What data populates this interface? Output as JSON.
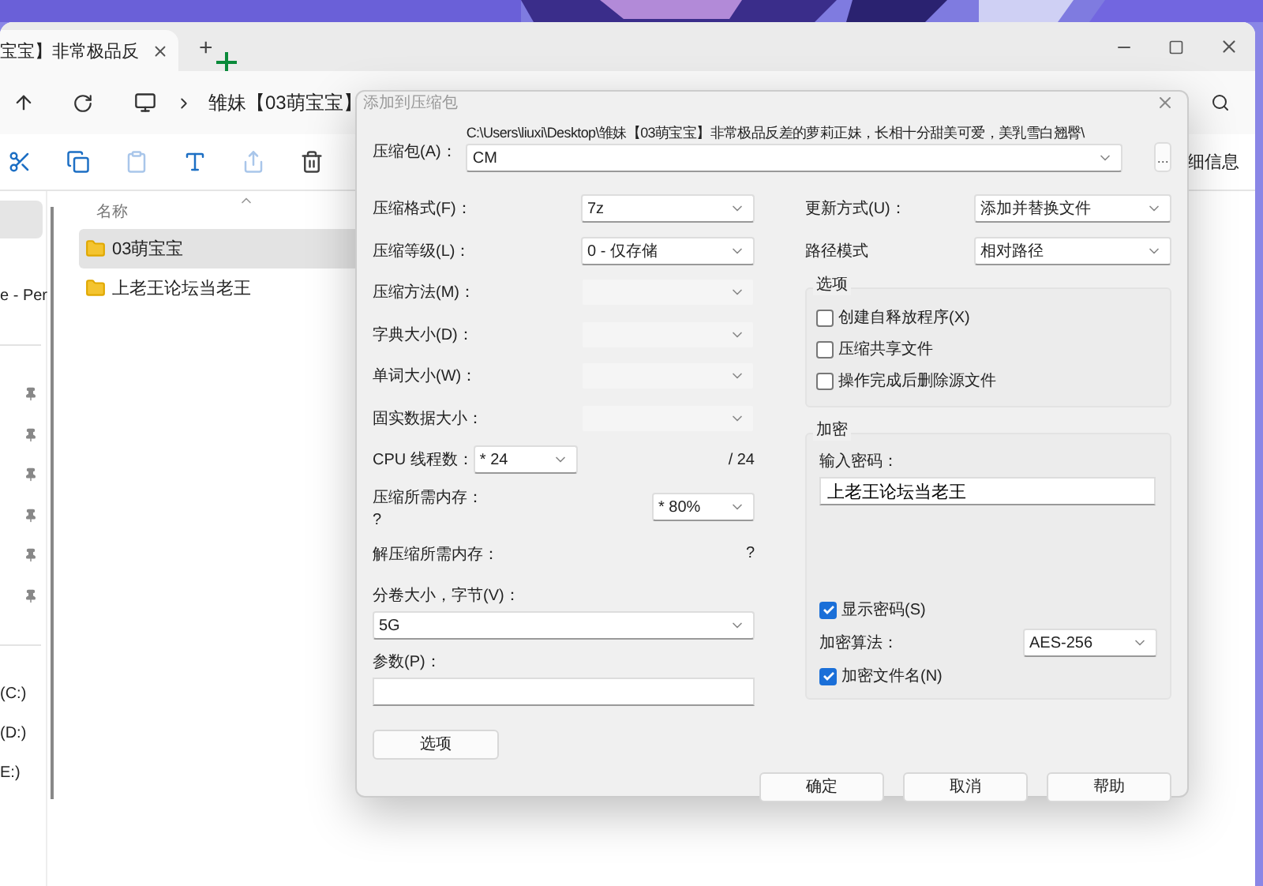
{
  "explorer": {
    "tab": {
      "title": "宝宝】非常极品反"
    },
    "new_tab": "+",
    "breadcrumb": "雏妹【03萌宝宝】",
    "toolbar_text": "细信息",
    "column_header": "名称",
    "sidebar": [
      {
        "kind": "selected"
      },
      {
        "kind": "text",
        "label": "e - Per"
      },
      {
        "kind": "divider"
      },
      {
        "kind": "pin"
      },
      {
        "kind": "pin"
      },
      {
        "kind": "pin"
      },
      {
        "kind": "pin"
      },
      {
        "kind": "pin"
      },
      {
        "kind": "pin"
      },
      {
        "kind": "divider"
      },
      {
        "kind": "text",
        "label": "(C:)"
      },
      {
        "kind": "text",
        "label": "(D:)"
      },
      {
        "kind": "text",
        "label": "E:)"
      }
    ],
    "files": [
      {
        "name": "03萌宝宝",
        "selected": true
      },
      {
        "name": "上老王论坛当老王",
        "selected": false
      }
    ]
  },
  "dialog": {
    "title": "添加到压缩包",
    "archive": {
      "label": "压缩包(A)：",
      "path": "C:\\Users\\liuxi\\Desktop\\雏妹【03萌宝宝】非常极品反差的萝莉正妹，长相十分甜美可爱，美乳雪白翘臀\\",
      "value": "CM",
      "browse": "..."
    },
    "left": [
      {
        "kind": "select",
        "label": "压缩格式(F)：",
        "value": "7z",
        "disabled": false
      },
      {
        "kind": "select",
        "label": "压缩等级(L)：",
        "value": "0 - 仅存储",
        "disabled": false
      },
      {
        "kind": "select",
        "label": "压缩方法(M)：",
        "disabled": true
      },
      {
        "kind": "select",
        "label": "字典大小(D)：",
        "disabled": true
      },
      {
        "kind": "select",
        "label": "单词大小(W)：",
        "disabled": true
      },
      {
        "kind": "select",
        "label": "固实数据大小：",
        "disabled": true
      },
      {
        "kind": "threads",
        "label": "CPU 线程数：",
        "value": "* 24",
        "total": "/ 24"
      },
      {
        "kind": "memory",
        "label": "压缩所需内存：",
        "note": "?",
        "value": "* 80%"
      },
      {
        "kind": "info",
        "label": "解压缩所需内存：",
        "note": "?"
      }
    ],
    "volume": {
      "label": "分卷大小，字节(V)：",
      "value": "5G"
    },
    "params": {
      "label": "参数(P)："
    },
    "right": [
      {
        "label": "更新方式(U)：",
        "value": "添加并替换文件"
      },
      {
        "label": "路径模式",
        "value": "相对路径"
      }
    ],
    "options": {
      "title": "选项",
      "items": [
        {
          "label": "创建自释放程序(X)",
          "checked": false
        },
        {
          "label": "压缩共享文件",
          "checked": false
        },
        {
          "label": "操作完成后删除源文件",
          "checked": false
        }
      ]
    },
    "encryption": {
      "title": "加密",
      "password_label": "输入密码：",
      "password": "上老王论坛当老王",
      "show_password": {
        "label": "显示密码(S)",
        "checked": true
      },
      "method_label": "加密算法：",
      "method": "AES-256",
      "encrypt_names": {
        "label": "加密文件名(N)",
        "checked": true
      }
    },
    "options_button": "选项",
    "buttons": [
      "确定",
      "取消",
      "帮助"
    ]
  }
}
